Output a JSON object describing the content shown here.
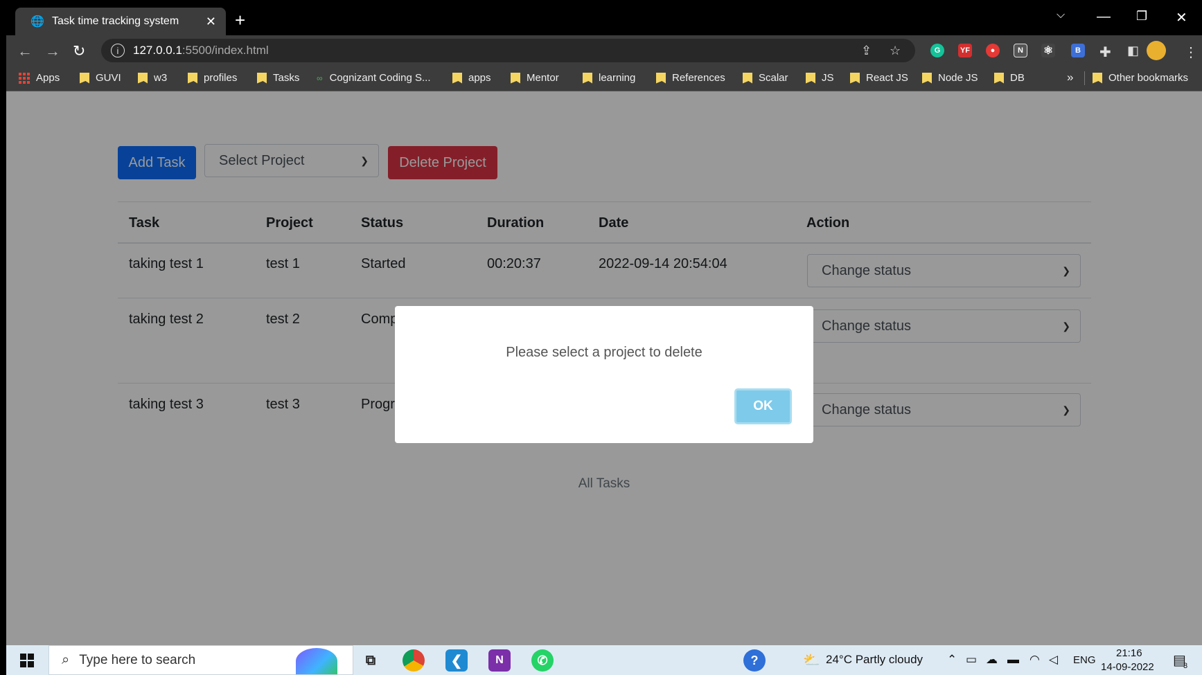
{
  "browser": {
    "tab_title": "Task time tracking system",
    "tab_close": "✕",
    "new_tab": "+",
    "url_host": "127.0.0.1",
    "url_path": ":5500/index.html",
    "bookmarks": [
      "Apps",
      "GUVI",
      "w3",
      "profiles",
      "Tasks",
      "Cognizant Coding S...",
      "apps",
      "Mentor",
      "learning",
      "References",
      "Scalar",
      "JS",
      "React JS",
      "Node JS",
      "DB"
    ],
    "more_bookmarks": "»",
    "other_bookmarks": "Other bookmarks",
    "extensions": [
      {
        "label": "G",
        "color": "#15c39a"
      },
      {
        "label": "YF",
        "color": "#d32f2f"
      },
      {
        "label": "●",
        "color": "#e53935"
      },
      {
        "label": "N",
        "color": "#555555"
      },
      {
        "label": "⚛",
        "color": "#444444"
      },
      {
        "label": "B",
        "color": "#3d6fd6"
      }
    ]
  },
  "toolbar": {
    "add_task_label": "Add Task",
    "select_project_placeholder": "Select Project",
    "delete_project_label": "Delete Project"
  },
  "colors": {
    "primary": "#0d6efd",
    "danger": "#dc3545",
    "ok_button": "#7ecaea"
  },
  "table": {
    "headers": [
      "Task",
      "Project",
      "Status",
      "Duration",
      "Date",
      "Action"
    ],
    "rows": [
      {
        "task": "taking test 1",
        "project": "test 1",
        "status": "Started",
        "duration": "00:20:37",
        "date": "2022-09-14 20:54:04",
        "action": "Change status"
      },
      {
        "task": "taking test 2",
        "project": "test 2",
        "status": "Comp",
        "duration": "",
        "date": "",
        "action": "Change status"
      },
      {
        "task": "taking test 3",
        "project": "test 3",
        "status": "Progr",
        "duration": "",
        "date": "",
        "action": "Change status"
      }
    ]
  },
  "footer": {
    "label": "All Tasks"
  },
  "modal": {
    "message": "Please select a project to delete",
    "ok_label": "OK"
  },
  "taskbar": {
    "search_placeholder": "Type here to search",
    "weather": "24°C  Partly cloudy",
    "language": "ENG",
    "time": "21:16",
    "date": "14-09-2022",
    "notification_count": "3"
  }
}
